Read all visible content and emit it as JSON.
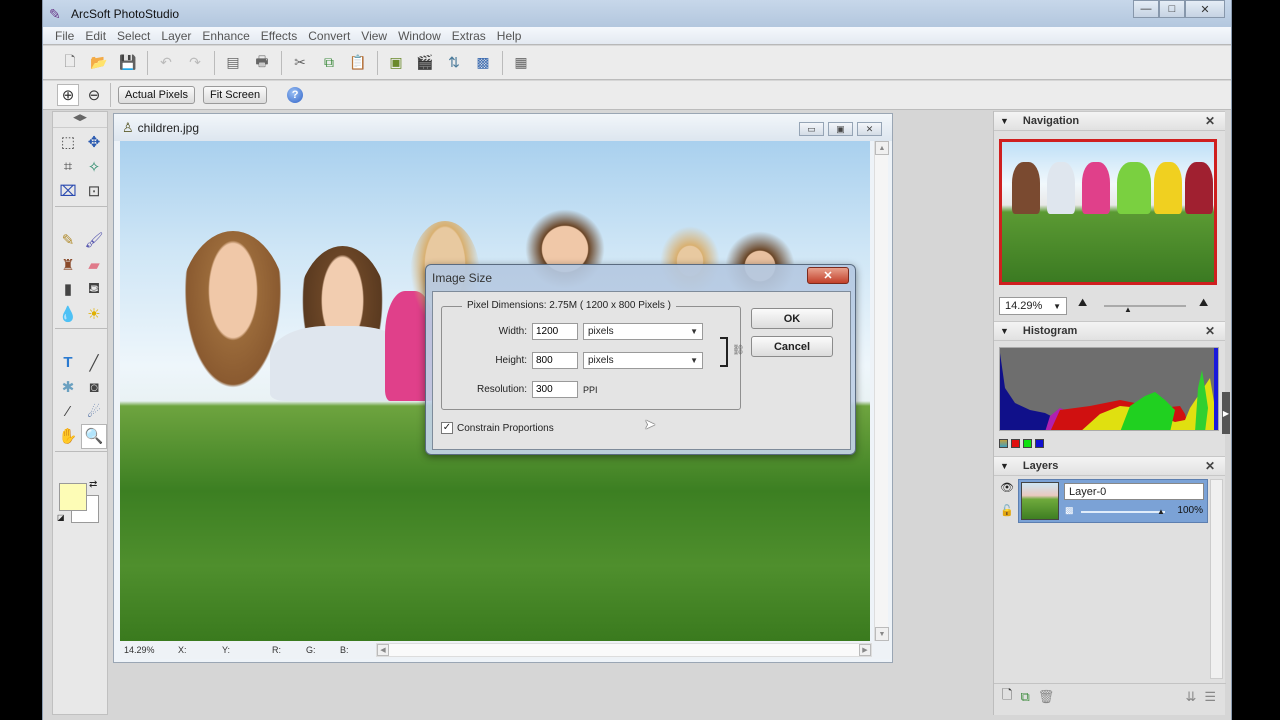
{
  "app": {
    "title": "ArcSoft PhotoStudio",
    "window_controls": {
      "minimize": "—",
      "maximize": "□",
      "close": "✕"
    }
  },
  "menu": [
    "File",
    "Edit",
    "Select",
    "Layer",
    "Enhance",
    "Effects",
    "Convert",
    "View",
    "Window",
    "Extras",
    "Help"
  ],
  "toolbar": {
    "icons": [
      "new-file-icon",
      "open-file-icon",
      "save-icon",
      "undo-icon",
      "redo-icon",
      "scan-icon",
      "print-icon",
      "cut-icon",
      "copy-icon",
      "paste-icon",
      "image-icon",
      "camera-icon",
      "compare-icon",
      "photo-icon",
      "batch-icon"
    ]
  },
  "zoombar": {
    "actual_pixels": "Actual Pixels",
    "fit_screen": "Fit Screen",
    "help": "?"
  },
  "toolbox": {
    "tools": [
      "rectangle-select",
      "move",
      "lasso-select",
      "magic-wand",
      "crop",
      "transform",
      "pencil",
      "brush",
      "stamp",
      "eraser",
      "gradient",
      "fill-bucket",
      "blur",
      "dodge",
      "text",
      "line",
      "shape",
      "rect-shape",
      "eyedropper",
      "smudge",
      "hand",
      "zoom"
    ],
    "foreground_color": "#fdfcb6",
    "background_color": "#ffffff"
  },
  "document": {
    "filename": "children.jpg",
    "status": {
      "zoom": "14.29%",
      "x": "X:",
      "y": "Y:",
      "r": "R:",
      "g": "G:",
      "b": "B:"
    }
  },
  "dialog": {
    "title": "Image Size",
    "close": "✕",
    "pixel_dimensions": "Pixel Dimensions:  2.75M  ( 1200 x 800  Pixels )",
    "width_label": "Width:",
    "width_value": "1200",
    "width_unit": "pixels",
    "height_label": "Height:",
    "height_value": "800",
    "height_unit": "pixels",
    "resolution_label": "Resolution:",
    "resolution_value": "300",
    "resolution_unit": "PPI",
    "ok": "OK",
    "cancel": "Cancel",
    "constrain_label": "Constrain Proportions",
    "constrain_checked": true
  },
  "navigation": {
    "title": "Navigation",
    "zoom": "14.29%"
  },
  "histogram": {
    "title": "Histogram",
    "channels": [
      "rgb",
      "red",
      "green",
      "blue"
    ]
  },
  "layers": {
    "title": "Layers",
    "items": [
      {
        "name": "Layer-0",
        "opacity": "100%"
      }
    ]
  },
  "colors": {
    "accent_red": "#cf1f1f",
    "layer_selected": "#7ba2d6"
  }
}
